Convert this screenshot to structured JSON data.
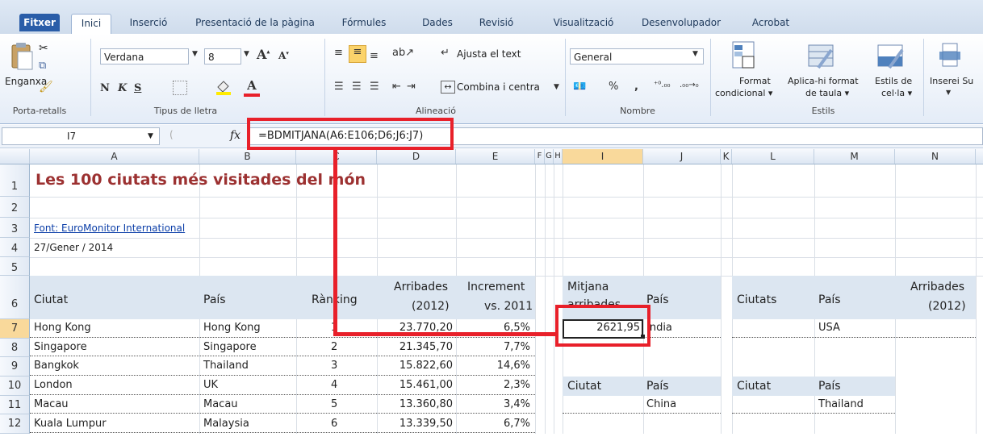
{
  "ribbon_tabs": [
    "Fitxer",
    "Inici",
    "Inserció",
    "Presentació de la pàgina",
    "Fórmules",
    "Dades",
    "Revisió",
    "Visualització",
    "Desenvolupador",
    "Acrobat"
  ],
  "clipboard": {
    "paste_label": "Enganxa",
    "group": "Porta-retalls"
  },
  "font": {
    "name": "Verdana",
    "size": "8",
    "bold": "N",
    "italic": "K",
    "underline": "S",
    "group": "Tipus de lletra"
  },
  "alignment": {
    "wrap": "Ajusta el text",
    "merge": "Combina i centra",
    "group": "Alineació"
  },
  "number": {
    "format": "General",
    "percent": "%",
    "comma": ",",
    "group": "Nombre"
  },
  "styles": {
    "conditional": [
      "Format",
      "condicional"
    ],
    "as_table": [
      "Aplica-hi format",
      "de taula"
    ],
    "cell_styles": [
      "Estils de",
      "cel·la"
    ],
    "group": "Estils"
  },
  "cells": {
    "insert": "Inserei",
    "insert_sub": "Su"
  },
  "formula_bar": {
    "name_box": "I7",
    "fx": "fx",
    "formula": "=BDMITJANA(A6:E106;D6;J6:J7)"
  },
  "columns": [
    "A",
    "B",
    "C",
    "D",
    "E",
    "F",
    "G",
    "H",
    "I",
    "J",
    "K",
    "L",
    "M",
    "N"
  ],
  "rows": [
    "1",
    "2",
    "3",
    "4",
    "5",
    "6",
    "7",
    "8",
    "9",
    "10",
    "11",
    "12"
  ],
  "sheet": {
    "title": "Les 100 ciutats més visitades del món",
    "source": "Font: EuroMonitor International",
    "date": "27/Gener / 2014",
    "headers": {
      "ciutat": "Ciutat",
      "pais": "País",
      "ranking": "Rànking",
      "arribades": [
        "Arribades",
        "(2012)"
      ],
      "increment": [
        "Increment",
        "vs. 2011"
      ]
    },
    "data": [
      {
        "city": "Hong Kong",
        "country": "Hong Kong",
        "rank": "1",
        "arrivals": "23.770,20",
        "inc": "6,5%"
      },
      {
        "city": "Singapore",
        "country": "Singapore",
        "rank": "2",
        "arrivals": "21.345,70",
        "inc": "7,7%"
      },
      {
        "city": "Bangkok",
        "country": "Thailand",
        "rank": "3",
        "arrivals": "15.822,60",
        "inc": "14,6%"
      },
      {
        "city": "London",
        "country": "UK",
        "rank": "4",
        "arrivals": "15.461,00",
        "inc": "2,3%"
      },
      {
        "city": "Macau",
        "country": "Macau",
        "rank": "5",
        "arrivals": "13.360,80",
        "inc": "3,4%"
      },
      {
        "city": "Kuala Lumpur",
        "country": "Malaysia",
        "rank": "6",
        "arrivals": "13.339,50",
        "inc": "6,7%"
      }
    ],
    "criteria1": {
      "h1": [
        "Mitjana",
        "arribades"
      ],
      "h2": "País",
      "result": "2621,95",
      "value": "India"
    },
    "criteria2": {
      "h1": "Ciutats",
      "h2": "País",
      "h3": [
        "Arribades",
        "(2012)"
      ],
      "value": "USA"
    },
    "criteria3": {
      "h1": "Ciutat",
      "h2": "País",
      "value": "China"
    },
    "criteria4": {
      "h1": "Ciutat",
      "h2": "País",
      "value": "Thailand"
    }
  },
  "colors": {
    "title": "#9c3131",
    "link": "#0b3ea8",
    "header_fill": "#dce6f1",
    "highlight": "#e8202a"
  }
}
